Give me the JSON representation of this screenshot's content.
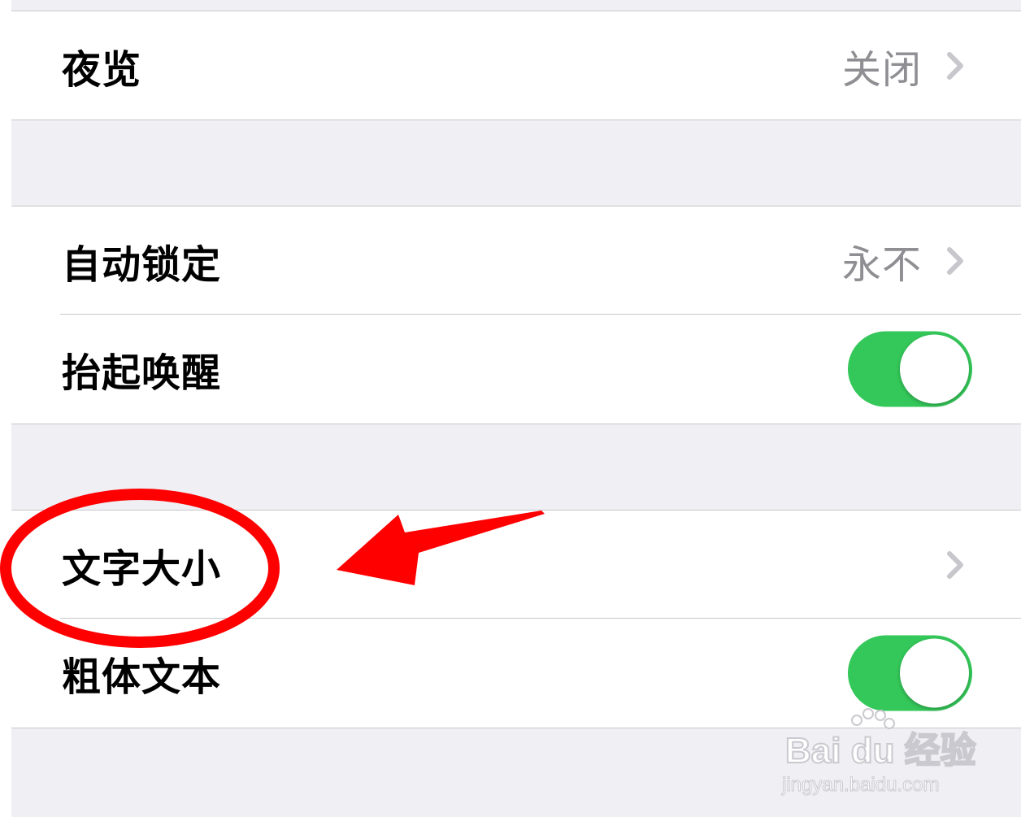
{
  "rows": {
    "night_shift": {
      "label": "夜览",
      "value": "关闭"
    },
    "auto_lock": {
      "label": "自动锁定",
      "value": "永不"
    },
    "raise_to_wake": {
      "label": "抬起唤醒",
      "on": true
    },
    "text_size": {
      "label": "文字大小"
    },
    "bold_text": {
      "label": "粗体文本",
      "on": true
    }
  },
  "icons": [
    "chevron-right-icon",
    "toggle-switch"
  ],
  "annotation": {
    "type": "red-ellipse-and-arrow",
    "color": "#ff0000",
    "target": "文字大小"
  },
  "watermark": {
    "logo": "Bai du 经验",
    "url": "jingyan.baidu.com"
  },
  "colors": {
    "background": "#efeff4",
    "separator": "#c8c7cc",
    "toggle_on": "#34c759",
    "secondary_text": "#8e8e93"
  }
}
